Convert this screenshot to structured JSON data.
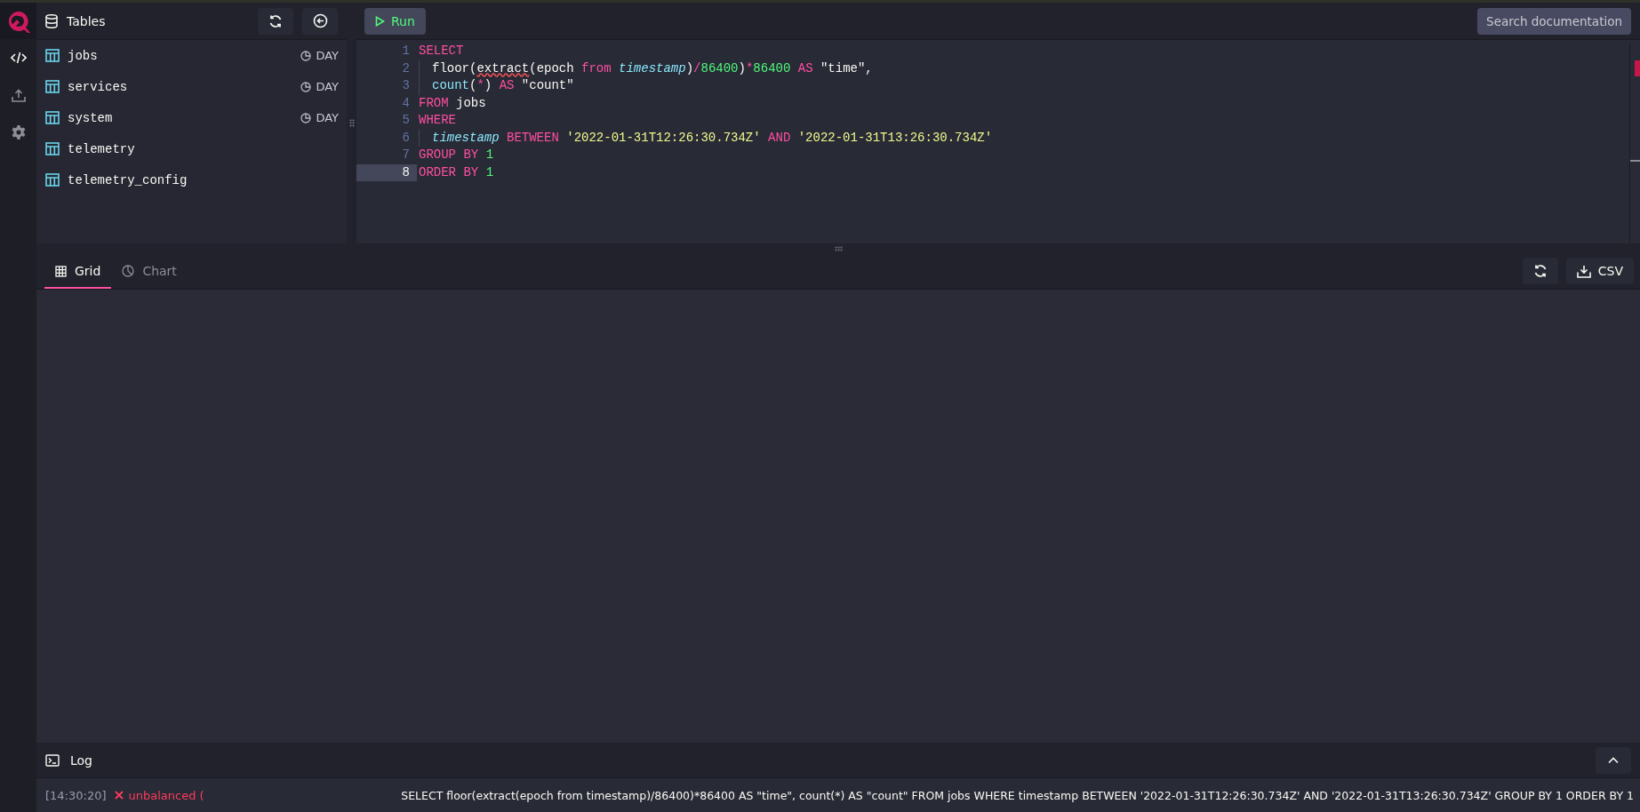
{
  "nav": [
    {
      "kind": "editor",
      "selected": true
    },
    {
      "kind": "import",
      "selected": false
    },
    {
      "kind": "settings",
      "selected": false
    }
  ],
  "tables_panel": {
    "title": "Tables",
    "tables": [
      {
        "name": "jobs",
        "partition": "DAY"
      },
      {
        "name": "services",
        "partition": "DAY"
      },
      {
        "name": "system",
        "partition": "DAY"
      },
      {
        "name": "telemetry"
      },
      {
        "name": "telemetry_config"
      }
    ]
  },
  "toolbar": {
    "run_button": "Run",
    "search_button": "Search documentation"
  },
  "editor": {
    "error_marker": true,
    "lines": [
      {
        "number": "1",
        "active": false,
        "indent": false,
        "tokens": [
          {
            "kind": "keyword",
            "text": "SELECT"
          }
        ]
      },
      {
        "number": "2",
        "active": false,
        "indent": true,
        "tokens": [
          {
            "kind": "text",
            "text": "floor("
          },
          {
            "kind": "error",
            "text": "extract"
          },
          {
            "kind": "text",
            "text": "(epoch "
          },
          {
            "kind": "keyword",
            "text": "from "
          },
          {
            "kind": "column",
            "text": "timestamp"
          },
          {
            "kind": "text",
            "text": ")"
          },
          {
            "kind": "operator",
            "text": "/"
          },
          {
            "kind": "number",
            "text": "86400"
          },
          {
            "kind": "text",
            "text": ")"
          },
          {
            "kind": "operator",
            "text": "*"
          },
          {
            "kind": "number",
            "text": "86400 "
          },
          {
            "kind": "keyword",
            "text": "AS"
          },
          {
            "kind": "text",
            "text": " \"time\","
          }
        ]
      },
      {
        "number": "3",
        "active": false,
        "indent": true,
        "tokens": [
          {
            "kind": "function",
            "text": "count"
          },
          {
            "kind": "text",
            "text": "("
          },
          {
            "kind": "operator",
            "text": "*"
          },
          {
            "kind": "text",
            "text": ") "
          },
          {
            "kind": "keyword",
            "text": "AS"
          },
          {
            "kind": "text",
            "text": " \"count\""
          }
        ]
      },
      {
        "number": "4",
        "active": false,
        "indent": false,
        "tokens": [
          {
            "kind": "keyword",
            "text": "FROM"
          },
          {
            "kind": "text",
            "text": " jobs"
          }
        ]
      },
      {
        "number": "5",
        "active": false,
        "indent": false,
        "tokens": [
          {
            "kind": "keyword",
            "text": "WHERE"
          }
        ]
      },
      {
        "number": "6",
        "active": false,
        "indent": true,
        "tokens": [
          {
            "kind": "column",
            "text": "timestamp "
          },
          {
            "kind": "keyword",
            "text": "BETWEEN "
          },
          {
            "kind": "string",
            "text": "'2022-01-31T12:26:30.734Z' "
          },
          {
            "kind": "keyword",
            "text": "AND "
          },
          {
            "kind": "string",
            "text": "'2022-01-31T13:26:30.734Z'"
          }
        ]
      },
      {
        "number": "7",
        "active": false,
        "indent": false,
        "tokens": [
          {
            "kind": "keyword",
            "text": "GROUP BY "
          },
          {
            "kind": "number",
            "text": "1"
          }
        ]
      },
      {
        "number": "8",
        "active": true,
        "indent": false,
        "tokens": [
          {
            "kind": "keyword",
            "text": "ORDER BY "
          },
          {
            "kind": "number",
            "text": "1"
          }
        ]
      }
    ]
  },
  "results": {
    "tabs": [
      {
        "kind": "grid",
        "label": "Grid",
        "selected": true
      },
      {
        "kind": "chart",
        "label": "Chart",
        "selected": false
      }
    ],
    "csv_button": "CSV"
  },
  "log": {
    "title": "Log",
    "expanded": false,
    "entries": [
      {
        "time": "[14:30:20]",
        "error": true,
        "message": "unbalanced (",
        "query": "SELECT floor(extract(epoch from timestamp)/86400)*86400 AS \"time\", count(*) AS \"count\" FROM jobs WHERE timestamp BETWEEN '2022-01-31T12:26:30.734Z' AND '2022-01-31T13:26:30.734Z' GROUP BY 1 ORDER BY 1"
      }
    ]
  }
}
